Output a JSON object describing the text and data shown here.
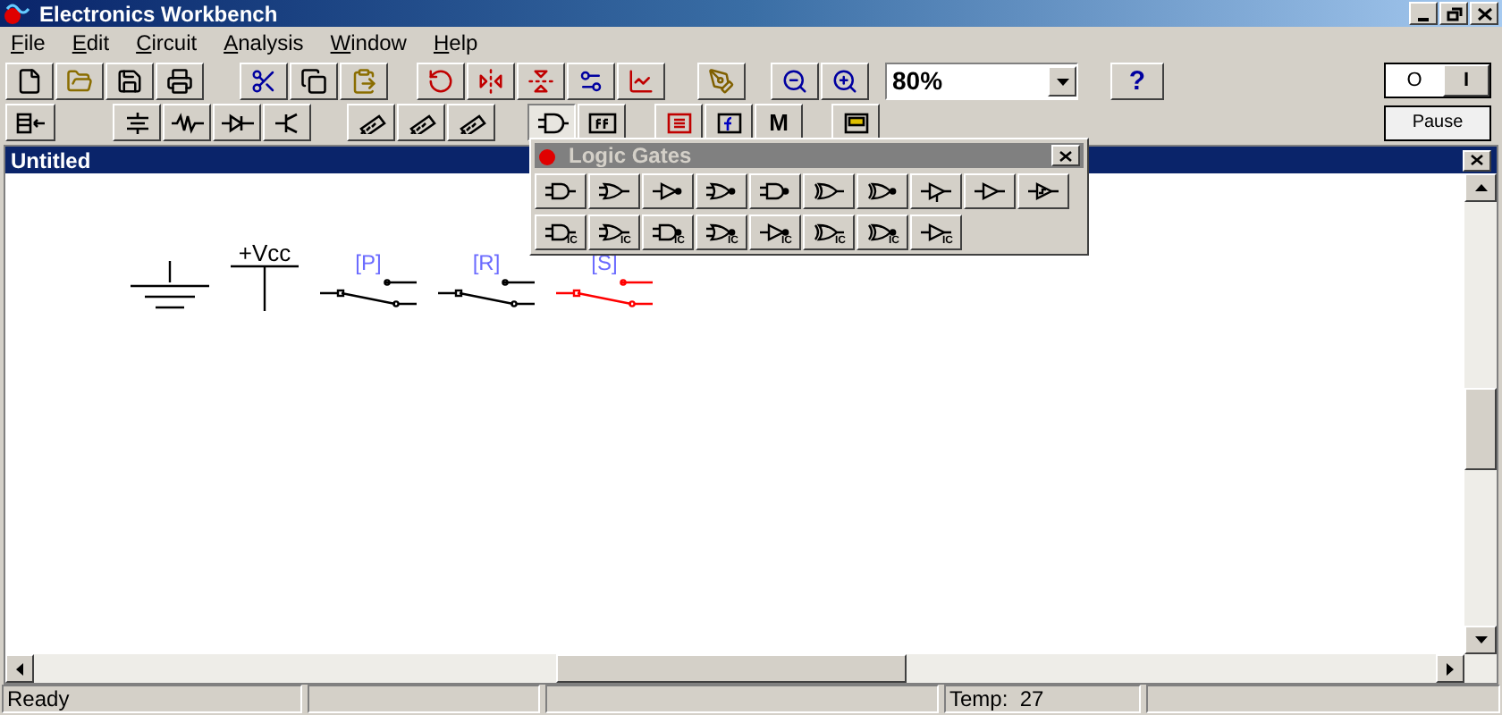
{
  "window": {
    "title": "Electronics Workbench"
  },
  "menu": [
    {
      "label": "File",
      "mnemonic_underlined": true
    },
    {
      "label": "Edit",
      "mnemonic_underlined": true
    },
    {
      "label": "Circuit",
      "mnemonic_underlined": true
    },
    {
      "label": "Analysis",
      "mnemonic_underlined": true
    },
    {
      "label": "Window",
      "mnemonic_underlined": true
    },
    {
      "label": "Help",
      "mnemonic_underlined": true
    }
  ],
  "zoom": {
    "value": "80%"
  },
  "help_button": "?",
  "mode_button": "M",
  "power_switch": {
    "off_label": "O",
    "on_label": "I",
    "on": true
  },
  "pause_button": "Pause",
  "circuit_window": {
    "title": "Untitled"
  },
  "components": [
    {
      "kind": "ground"
    },
    {
      "kind": "vcc",
      "label": "+Vcc"
    },
    {
      "kind": "switch",
      "label": "[P]",
      "selected": false
    },
    {
      "kind": "switch",
      "label": "[R]",
      "selected": false
    },
    {
      "kind": "switch",
      "label": "[S]",
      "selected": true
    }
  ],
  "logic_gates": {
    "title": "Logic Gates",
    "rows": [
      [
        {
          "kind": "and"
        },
        {
          "kind": "or"
        },
        {
          "kind": "not"
        },
        {
          "kind": "nor"
        },
        {
          "kind": "nand"
        },
        {
          "kind": "xor"
        },
        {
          "kind": "xnor"
        },
        {
          "kind": "tristate"
        },
        {
          "kind": "buffer"
        },
        {
          "kind": "schmitt"
        }
      ],
      [
        {
          "kind": "and",
          "sub": "IC"
        },
        {
          "kind": "or",
          "sub": "IC"
        },
        {
          "kind": "nand",
          "sub": "IC"
        },
        {
          "kind": "nor",
          "sub": "IC"
        },
        {
          "kind": "not",
          "sub": "IC"
        },
        {
          "kind": "xor",
          "sub": "IC"
        },
        {
          "kind": "xnor",
          "sub": "IC"
        },
        {
          "kind": "buffer",
          "sub": "IC"
        }
      ]
    ]
  },
  "status_bar": {
    "message": "Ready",
    "temperature": "Temp:  27"
  }
}
